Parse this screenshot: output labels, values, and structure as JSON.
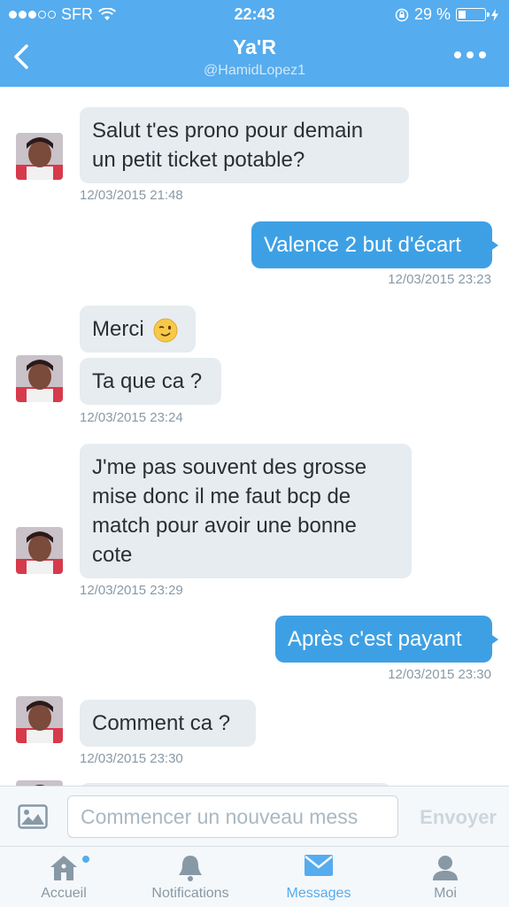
{
  "status_bar": {
    "carrier": "SFR",
    "time": "22:43",
    "battery": "29 %"
  },
  "header": {
    "title": "Ya'R",
    "handle": "@HamidLopez1"
  },
  "messages": [
    {
      "text_lines": [
        "Salut t'es prono pour demain",
        "un petit ticket potable?"
      ],
      "timestamp": "12/03/2015 21:48"
    },
    {
      "text": "Valence 2 but d'écart",
      "timestamp": "12/03/2015 23:23"
    },
    {
      "text": "Merci"
    },
    {
      "text": "Ta que ca ?",
      "timestamp": "12/03/2015 23:24"
    },
    {
      "text_lines": [
        "J'me pas souvent des grosse",
        "mise donc il me faut bcp de",
        "match pour avoir une bonne",
        "cote"
      ],
      "timestamp": "12/03/2015 23:29"
    },
    {
      "text": "Après c'est payant",
      "timestamp": "12/03/2015 23:30"
    },
    {
      "text": "Comment ca ?",
      "timestamp": "12/03/2015 23:30"
    }
  ],
  "compose": {
    "placeholder": "Commencer un nouveau mess",
    "send_label": "Envoyer"
  },
  "tabs": [
    {
      "label": "Accueil",
      "icon": "home-icon"
    },
    {
      "label": "Notifications",
      "icon": "bell-icon"
    },
    {
      "label": "Messages",
      "icon": "envelope-icon",
      "active": true
    },
    {
      "label": "Moi",
      "icon": "person-icon"
    }
  ],
  "colors": {
    "header": "#55acee",
    "outgoing_bubble": "#3ea0e4",
    "incoming_bubble": "#e6ecf0",
    "timestamp": "#8899a6",
    "active_tab": "#55acee"
  }
}
